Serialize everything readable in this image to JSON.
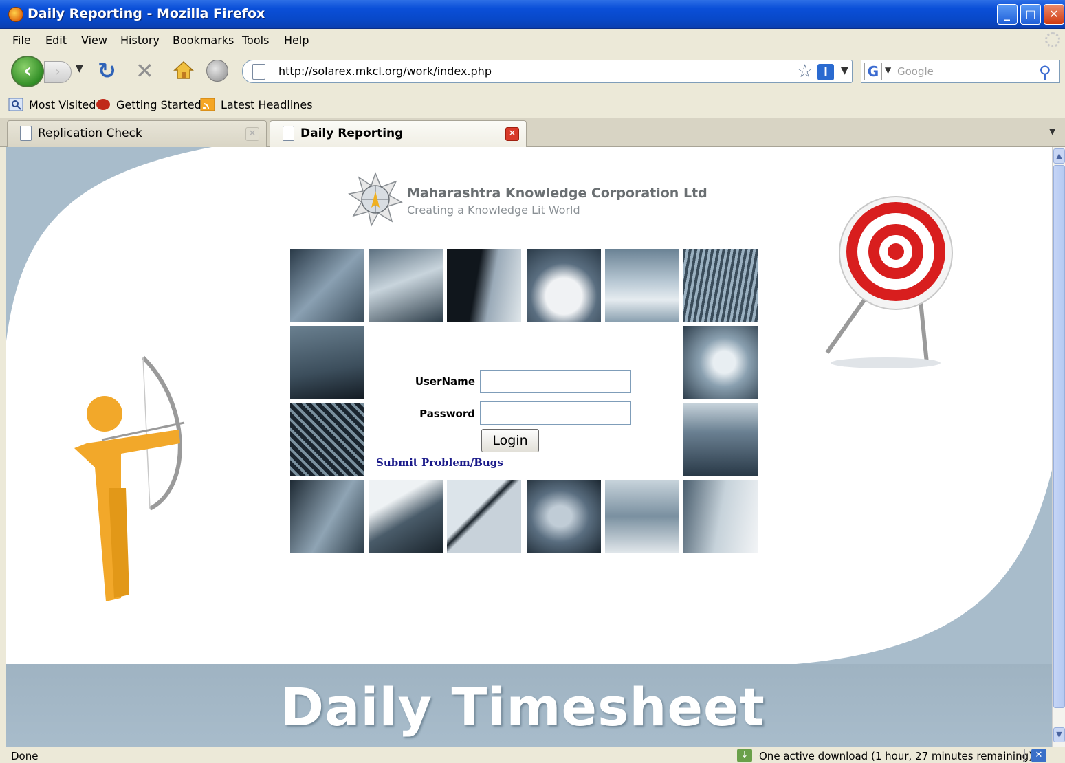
{
  "window": {
    "title": "Daily Reporting - Mozilla Firefox",
    "minimize": "_",
    "maximize": "□",
    "close": "✕"
  },
  "menu": [
    "File",
    "Edit",
    "View",
    "History",
    "Bookmarks",
    "Tools",
    "Help"
  ],
  "navbar": {
    "url": "http://solarex.mkcl.org/work/index.php",
    "search_placeholder": "Google",
    "search_engine": "G"
  },
  "bookmarks": [
    "Most Visited",
    "Getting Started",
    "Latest Headlines"
  ],
  "tabs": [
    {
      "label": "Replication Check",
      "active": false
    },
    {
      "label": "Daily Reporting",
      "active": true
    }
  ],
  "page": {
    "org_name": "Maharashtra Knowledge Corporation Ltd",
    "org_tagline": "Creating a Knowledge Lit World",
    "login": {
      "username_label": "UserName",
      "password_label": "Password",
      "username_value": "",
      "password_value": "",
      "button_label": "Login",
      "bugs_link": "Submit Problem/Bugs"
    },
    "banner": "Daily Timesheet"
  },
  "status": {
    "left": "Done",
    "download": "One active download (1 hour, 27 minutes remaining)"
  },
  "colors": {
    "titlebar": "#0848c8",
    "page_background": "#a8bccb",
    "archer": "#f2a82a",
    "target_red": "#d81e1e",
    "link": "#1a1a8a"
  },
  "icons": {
    "back": "back-arrow-icon",
    "forward": "forward-arrow-icon",
    "reload": "reload-icon",
    "stop": "stop-icon",
    "home": "home-icon",
    "search": "magnifier-icon"
  }
}
